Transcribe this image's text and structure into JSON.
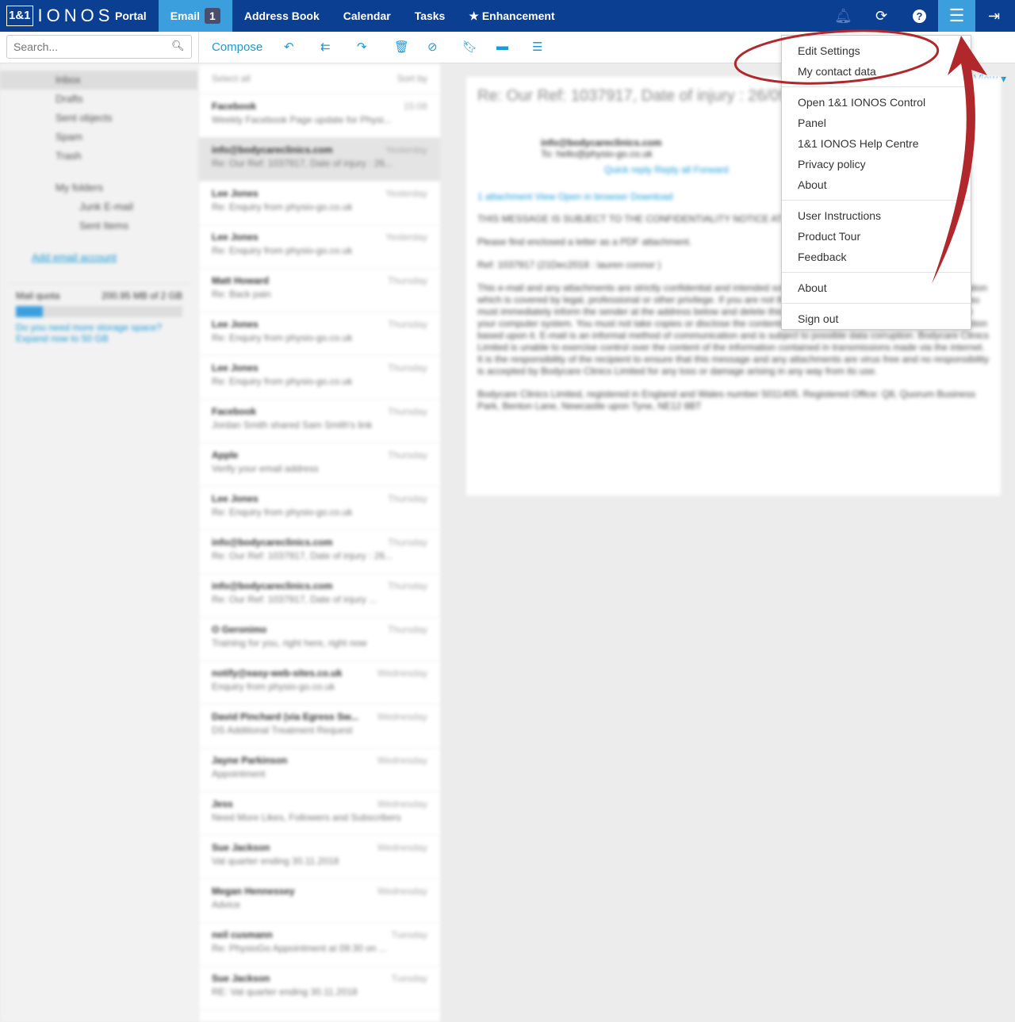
{
  "brand": {
    "box": "1&1",
    "name": "IONOS"
  },
  "nav": [
    {
      "label": "Portal"
    },
    {
      "label": "Email",
      "badge": "1"
    },
    {
      "label": "Address Book"
    },
    {
      "label": "Calendar"
    },
    {
      "label": "Tasks"
    },
    {
      "label": "Enhancement"
    }
  ],
  "search": {
    "placeholder": "Search..."
  },
  "toolbar": {
    "compose": "Compose",
    "view": "View"
  },
  "sidebar": {
    "folders": [
      "Inbox",
      "Drafts",
      "Sent objects",
      "Spam",
      "Trash"
    ],
    "my_folders": "My folders",
    "subfolders": [
      "Junk E-mail",
      "Sent Items"
    ],
    "add_account": "Add email account",
    "quota_label": "Mail quota",
    "quota_value": "200.95 MB of 2 GB",
    "quota_pct": 10,
    "more_storage": "Do you need more storage space?",
    "expand": "Expand now to 50 GB"
  },
  "list": {
    "select_all": "Select all",
    "sort": "Sort by",
    "items": [
      {
        "from": "Facebook",
        "date": "15:08",
        "subject": "Weekly Facebook Page update for Physi..."
      },
      {
        "from": "info@bodycareclinics.com",
        "date": "Yesterday",
        "subject": "Re: Our Ref: 1037917, Date of injury : 26..."
      },
      {
        "from": "Lee Jones",
        "date": "Yesterday",
        "subject": "Re: Enquiry from physio-go.co.uk"
      },
      {
        "from": "Lee Jones",
        "date": "Yesterday",
        "subject": "Re: Enquiry from physio-go.co.uk"
      },
      {
        "from": "Matt Howard",
        "date": "Thursday",
        "subject": "Re: Back pain"
      },
      {
        "from": "Lee Jones",
        "date": "Thursday",
        "subject": "Re: Enquiry from physio-go.co.uk"
      },
      {
        "from": "Lee Jones",
        "date": "Thursday",
        "subject": "Re: Enquiry from physio-go.co.uk"
      },
      {
        "from": "Facebook",
        "date": "Thursday",
        "subject": "Jordan Smith shared Sam Smith's link"
      },
      {
        "from": "Apple",
        "date": "Thursday",
        "subject": "Verify your email address"
      },
      {
        "from": "Lee Jones",
        "date": "Thursday",
        "subject": "Re: Enquiry from physio-go.co.uk"
      },
      {
        "from": "info@bodycareclinics.com",
        "date": "Thursday",
        "subject": "Re: Our Ref: 1037917, Date of injury : 26..."
      },
      {
        "from": "info@bodycareclinics.com",
        "date": "Thursday",
        "subject": "Re: Our Ref: 1037917, Date of injury ..."
      },
      {
        "from": "O Geronimo",
        "date": "Thursday",
        "subject": "Training for you, right here, right now"
      },
      {
        "from": "notify@easy-web-sites.co.uk",
        "date": "Wednesday",
        "subject": "Enquiry from physio-go.co.uk"
      },
      {
        "from": "David Pinchard (via Egress Sw...",
        "date": "Wednesday",
        "subject": "DS Additional Treatment Request"
      },
      {
        "from": "Jayne Parkinson",
        "date": "Wednesday",
        "subject": "Appointment"
      },
      {
        "from": "Jess",
        "date": "Wednesday",
        "subject": "Need More Likes, Followers and Subscribers"
      },
      {
        "from": "Sue Jackson",
        "date": "Wednesday",
        "subject": "Vat quarter ending 30.11.2018"
      },
      {
        "from": "Megan Hennessey",
        "date": "Wednesday",
        "subject": "Advice"
      },
      {
        "from": "neil cusmann",
        "date": "Tuesday",
        "subject": "Re: PhysioGo Appointment at 09:30 on ..."
      },
      {
        "from": "Sue Jackson",
        "date": "Tuesday",
        "subject": "RE: Vat quarter ending 30.11.2018"
      }
    ]
  },
  "reader": {
    "subject": "Re: Our Ref: 1037917, Date of injury : 26/09/2018, SOU0611/00121",
    "from": "info@bodycareclinics.com",
    "to": "To: hello@physio-go.co.uk",
    "actions": "Quick reply   Reply all   Forward",
    "attachment": "1 attachment   View   Open in browser   Download",
    "body": [
      "THIS MESSAGE IS SUBJECT TO THE CONFIDENTIALITY NOTICE AT THE END OF THIS COMMUNICATION",
      "Please find enclosed a letter as a PDF attachment.",
      "Ref: 1037917 (21Dec2018 : lauren connor )",
      "This e-mail and any attachments are strictly confidential and intended solely for the addressee. It may contain information which is covered by legal, professional or other privilege. If you are not the intended recipient of this document then you must immediately inform the sender at the address below and delete this e-mail and any attachments completely from your computer system. You must not take copies or disclose the contents of this document to anyone, nor take any action based upon it. E-mail is an informal method of communication and is subject to possible data corruption. Bodycare Clinics Limited is unable to exercise control over the content of the information contained in transmissions made via the internet. It is the responsibility of the recipient to ensure that this message and any attachments are virus free and no responsibility is accepted by Bodycare Clinics Limited for any loss or damage arising in any way from its use.",
      "Bodycare Clinics Limited, registered in England and Wales number 5011405. Registered Office: Q8, Quorum Business Park, Benton Lane, Newcastle upon Tyne, NE12 8BT"
    ]
  },
  "menu": {
    "groups": [
      [
        "Edit Settings",
        "My contact data"
      ],
      [
        "Open 1&1 IONOS Control Panel",
        "1&1 IONOS Help Centre",
        "Privacy policy",
        "About"
      ],
      [
        "User Instructions",
        "Product Tour",
        "Feedback"
      ],
      [
        "About"
      ],
      [
        "Sign out"
      ]
    ]
  },
  "colors": {
    "topbar": "#0b3f91",
    "active_tab": "#3c9fdd",
    "accent": "#1a9ad6",
    "annotation": "#b0272c"
  }
}
